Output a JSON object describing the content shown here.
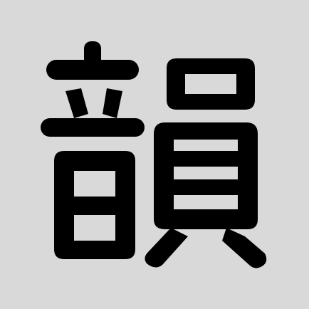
{
  "icon": {
    "glyph": "韻",
    "background_color": "#d9d9d9",
    "glyph_color": "#000000"
  }
}
